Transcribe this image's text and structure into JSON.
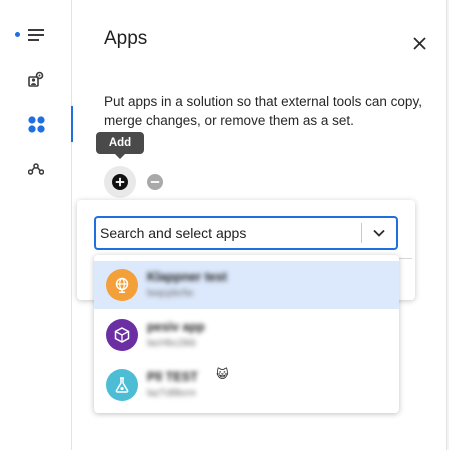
{
  "panel": {
    "title": "Apps",
    "description": "Put apps in a solution so that external tools can copy, merge changes, or remove them as a set.",
    "tooltip": "Add"
  },
  "rail": {
    "items": [
      {
        "icon": "list-icon",
        "active_dot": true
      },
      {
        "icon": "connection-settings-icon"
      },
      {
        "icon": "apps-grid-icon",
        "active": true
      },
      {
        "icon": "workflow-icon"
      }
    ]
  },
  "select": {
    "placeholder": "Search and select apps"
  },
  "options": [
    {
      "name": "Klappner test",
      "sub": "lwqcpbcfw",
      "icon": "globe-icon",
      "color": "#f4a03a"
    },
    {
      "name": "pesiv app",
      "sub": "lacHbc2ikb",
      "icon": "cube-icon",
      "color": "#6b2fa3"
    },
    {
      "name": "Pll TEST",
      "sub": "lazTd8bcm",
      "icon": "flask-icon",
      "color": "#4dbdd6",
      "emoji": "😺"
    }
  ],
  "colors": {
    "accent": "#1f6fe0",
    "highlight": "#dce8fb"
  }
}
